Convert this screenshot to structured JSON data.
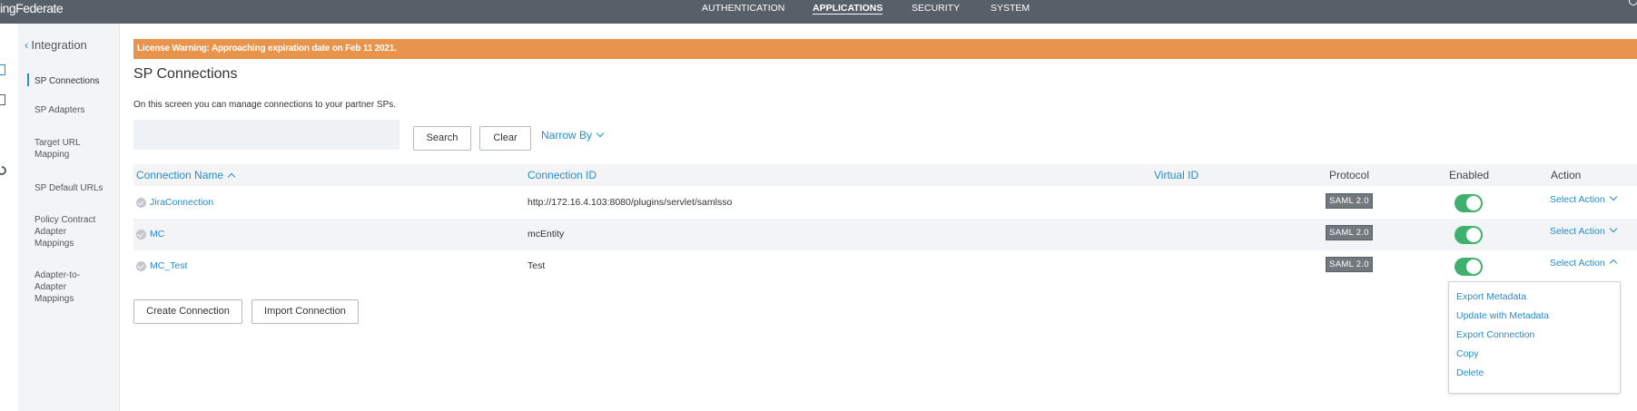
{
  "header": {
    "logo": "ingFederate",
    "nav": [
      "AUTHENTICATION",
      "APPLICATIONS",
      "SECURITY",
      "SYSTEM"
    ],
    "active_nav": "APPLICATIONS"
  },
  "sidebar": {
    "back_label": "Integration",
    "items": [
      {
        "label": "SP Connections"
      },
      {
        "label": "SP Adapters"
      },
      {
        "label": "Target URL Mapping"
      },
      {
        "label": "SP Default URLs"
      },
      {
        "label": "Policy Contract Adapter Mappings"
      },
      {
        "label": "Adapter-to-Adapter Mappings"
      }
    ],
    "active_item": "SP Connections"
  },
  "banner": {
    "text": "License Warning: Approaching expiration date on Feb 11 2021.",
    "color": "#e8944d"
  },
  "main": {
    "title": "SP Connections",
    "description": "On this screen you can manage connections to your partner SPs.",
    "search": {
      "value": "",
      "placeholder": ""
    },
    "search_label": "Search",
    "clear_label": "Clear",
    "narrow_label": "Narrow By"
  },
  "table": {
    "columns": [
      "Connection Name",
      "Connection ID",
      "Virtual ID",
      "Protocol",
      "Enabled",
      "Action"
    ],
    "rows": [
      {
        "name": "JiraConnection",
        "id": "http://172.16.4.103:8080/plugins/servlet/samlsso",
        "virtual_id": "",
        "protocol": "SAML 2.0",
        "enabled": true,
        "action": "Select Action"
      },
      {
        "name": "MC",
        "id": "mcEntity",
        "virtual_id": "",
        "protocol": "SAML 2.0",
        "enabled": true,
        "action": "Select Action"
      },
      {
        "name": "MC_Test",
        "id": "Test",
        "virtual_id": "",
        "protocol": "SAML 2.0",
        "enabled": true,
        "action": "Select Action"
      }
    ]
  },
  "buttons": {
    "create": "Create Connection",
    "import": "Import Connection"
  },
  "action_menu": {
    "items": [
      "Export Metadata",
      "Update with Metadata",
      "Export Connection",
      "Copy",
      "Delete"
    ]
  },
  "colors": {
    "accent": "#2a8bc5",
    "topbar": "#575f68",
    "toggle_on": "#3fb06d"
  },
  "icons": [
    "search-icon",
    "check-circle-icon",
    "chevron-down-icon",
    "chevron-up-icon",
    "chevron-left-icon"
  ]
}
